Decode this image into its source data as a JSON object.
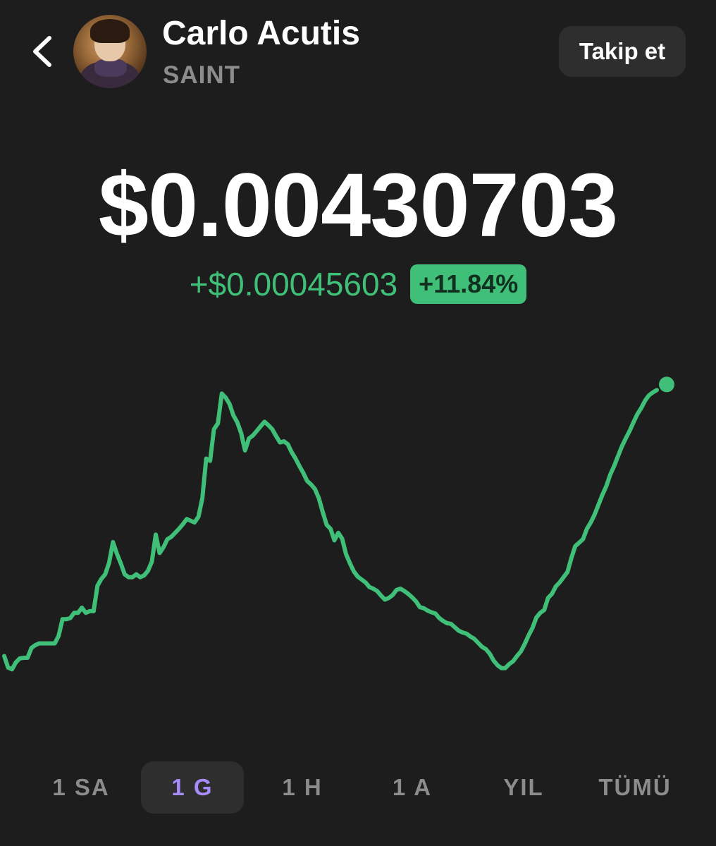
{
  "header": {
    "back_icon": "chevron-left-icon",
    "avatar_icon": "profile-photo",
    "name": "Carlo Acutis",
    "ticker": "SAINT",
    "follow_label": "Takip et"
  },
  "price": {
    "value": "$0.00430703",
    "change_abs": "+$0.00045603",
    "change_pct": "+11.84%"
  },
  "colors": {
    "background": "#1d1d1d",
    "positive": "#3fbf77",
    "muted": "#8c8c8c",
    "active_tab": "#a78bfa"
  },
  "tabs": [
    {
      "label": "1 SA",
      "active": false
    },
    {
      "label": "1 G",
      "active": true
    },
    {
      "label": "1 H",
      "active": false
    },
    {
      "label": "1 A",
      "active": false
    },
    {
      "label": "YIL",
      "active": false
    },
    {
      "label": "TÜMÜ",
      "active": false
    }
  ],
  "chart_data": {
    "type": "line",
    "title": "",
    "xlabel": "",
    "ylabel": "",
    "grid": false,
    "legend": "none",
    "series": [
      {
        "color": "#3fbf77",
        "values": [
          0.003845,
          0.003825,
          0.003822,
          0.003834,
          0.003841,
          0.003842,
          0.003842,
          0.003859,
          0.003864,
          0.003867,
          0.003867,
          0.003867,
          0.003867,
          0.003867,
          0.00388,
          0.003909,
          0.003909,
          0.003911,
          0.00392,
          0.00392,
          0.003929,
          0.00392,
          0.003923,
          0.003923,
          0.003967,
          0.003979,
          0.003987,
          0.004007,
          0.004043,
          0.004023,
          0.004006,
          0.003987,
          0.003982,
          0.003982,
          0.003987,
          0.003982,
          0.003985,
          0.003993,
          0.004009,
          0.004056,
          0.004024,
          0.004034,
          0.004048,
          0.004052,
          0.004059,
          0.004066,
          0.004074,
          0.004083,
          0.00408,
          0.004077,
          0.004087,
          0.004119,
          0.004188,
          0.004184,
          0.004239,
          0.004249,
          0.004301,
          0.004294,
          0.004283,
          0.004263,
          0.004251,
          0.004232,
          0.004202,
          0.004223,
          0.004228,
          0.004236,
          0.004244,
          0.004252,
          0.004246,
          0.004239,
          0.004227,
          0.004216,
          0.004218,
          0.004213,
          0.004199,
          0.004188,
          0.004175,
          0.004163,
          0.004149,
          0.004143,
          0.004135,
          0.004119,
          0.004095,
          0.004073,
          0.004066,
          0.004046,
          0.004059,
          0.004049,
          0.004022,
          0.004006,
          0.003992,
          0.003983,
          0.003978,
          0.003973,
          0.003965,
          0.003962,
          0.003958,
          0.00395,
          0.003943,
          0.003946,
          0.003951,
          0.00396,
          0.003962,
          0.003958,
          0.003953,
          0.003947,
          0.00394,
          0.00393,
          0.003928,
          0.003924,
          0.003921,
          0.003919,
          0.003911,
          0.003906,
          0.003902,
          0.003901,
          0.003895,
          0.003889,
          0.003886,
          0.003884,
          0.003879,
          0.003875,
          0.003868,
          0.003861,
          0.003857,
          0.003849,
          0.003837,
          0.003829,
          0.003824,
          0.003824,
          0.003831,
          0.003836,
          0.003845,
          0.003853,
          0.003866,
          0.003881,
          0.003894,
          0.003912,
          0.00392,
          0.003925,
          0.003946,
          0.003953,
          0.003966,
          0.003973,
          0.003982,
          0.003991,
          0.004015,
          0.004036,
          0.004042,
          0.004048,
          0.004066,
          0.004077,
          0.004091,
          0.004108,
          0.004125,
          0.00414,
          0.00416,
          0.004175,
          0.004192,
          0.004209,
          0.004223,
          0.004236,
          0.004251,
          0.004265,
          0.004276,
          0.004289,
          0.004298,
          0.004303,
          0.004307
        ]
      }
    ],
    "y_range": [
      0.00376,
      0.00436
    ]
  }
}
